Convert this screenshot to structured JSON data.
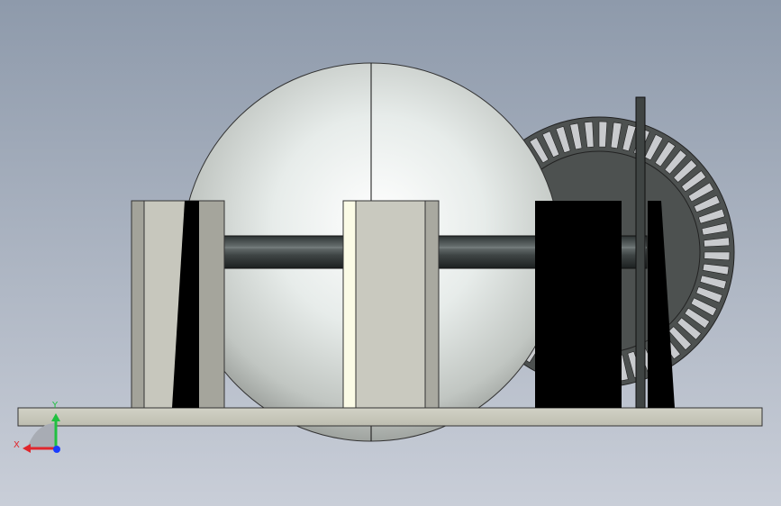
{
  "view": {
    "background_top": "#8e9aab",
    "background_bottom": "#c9ced8"
  },
  "triad": {
    "x_label": "X",
    "y_label": "Y",
    "x_color": "#e0262c",
    "y_color": "#20c040",
    "z_color": "#1a3cff"
  },
  "colors": {
    "sphere_light": "#ffffff",
    "sphere_mid": "#c8ccc8",
    "sphere_dark": "#8f938f",
    "plate": "#c9c9be",
    "shaft": "#3e4444",
    "dark_part": "#4d5150",
    "black_part": "#000000",
    "edge": "#222222"
  }
}
